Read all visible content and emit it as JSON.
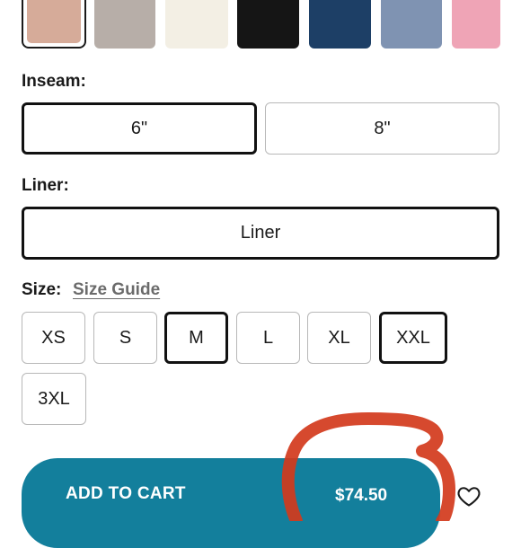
{
  "colors": {
    "swatches": [
      "#d6ab99",
      "#b7aea8",
      "#f3efe4",
      "#151515",
      "#1d3f66",
      "#7f93b2",
      "#efa4b6"
    ],
    "accent": "#137f9c",
    "annotation": "#d23a1c"
  },
  "inseam": {
    "label": "Inseam:",
    "options": [
      "6\"",
      "8\""
    ],
    "selected": "6\""
  },
  "liner": {
    "label": "Liner:",
    "option": "Liner"
  },
  "size": {
    "label": "Size:",
    "guide_link": "Size Guide",
    "options": [
      "XS",
      "S",
      "M",
      "L",
      "XL",
      "XXL",
      "3XL"
    ]
  },
  "cart": {
    "button_label": "ADD TO CART",
    "price": "$74.50"
  },
  "icons": {
    "wishlist": "heart-icon"
  }
}
